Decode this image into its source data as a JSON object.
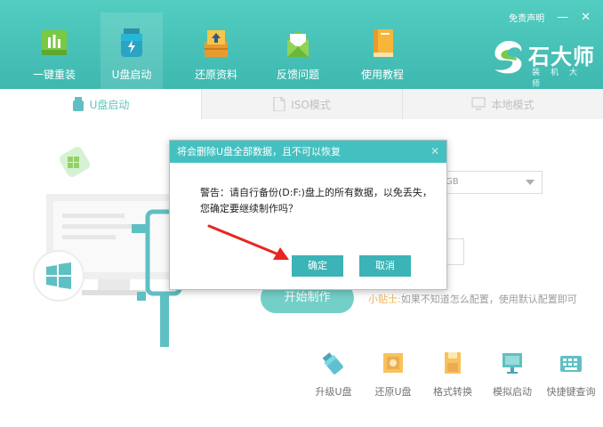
{
  "header": {
    "nav": [
      {
        "label": "一键重装",
        "icon": "bar-chart-icon"
      },
      {
        "label": "U盘启动",
        "icon": "usb-drive-icon"
      },
      {
        "label": "还原资料",
        "icon": "restore-box-icon"
      },
      {
        "label": "反馈问题",
        "icon": "mail-icon"
      },
      {
        "label": "使用教程",
        "icon": "book-icon"
      }
    ],
    "disclaimer": "免责声明",
    "minimize": "—",
    "close": "✕",
    "brand_name": "石大师",
    "brand_sub": "装机大师"
  },
  "tabs": [
    {
      "label": "U盘启动",
      "icon": "usb-icon"
    },
    {
      "label": "ISO模式",
      "icon": "file-icon"
    },
    {
      "label": "本地模式",
      "icon": "monitor-icon"
    }
  ],
  "settings": {
    "select_value": "GB",
    "start_button": "开始制作",
    "tip_label": "小贴士:",
    "tip_text": "如果不知道怎么配置，使用默认配置即可"
  },
  "tools": [
    {
      "label": "升级U盘",
      "icon": "usb-upgrade-icon"
    },
    {
      "label": "还原U盘",
      "icon": "restore-usb-icon"
    },
    {
      "label": "格式转换",
      "icon": "format-convert-icon"
    },
    {
      "label": "模拟启动",
      "icon": "simulate-boot-icon"
    },
    {
      "label": "快捷键查询",
      "icon": "keyboard-icon"
    }
  ],
  "dialog": {
    "title": "将会删除U盘全部数据，且不可以恢复",
    "close": "✕",
    "line1": "警告：请自行备份(D:F:)盘上的所有数据，以免丢失，",
    "line2": "您确定要继续制作吗？",
    "ok": "确定",
    "cancel": "取消"
  },
  "colors": {
    "header": "#45bfb6",
    "accent": "#3cb3b6",
    "tip": "#f0a22d"
  }
}
